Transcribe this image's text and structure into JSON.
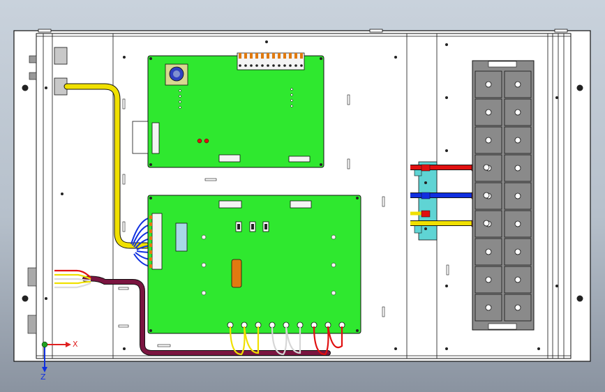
{
  "viewport": {
    "background_top": "#c9d2dc",
    "background_bottom": "#8a93a0"
  },
  "colors": {
    "enclosure": "#ffffff",
    "outline": "#111111",
    "pcb": "#2fe82f",
    "cable_yellow": "#f0e000",
    "cable_maroon": "#7a1540",
    "wire_red": "#e01010",
    "wire_blue": "#1030e0",
    "wire_white": "#f4f4f4",
    "busbar": "#5fd4d4",
    "breaker_block": "#8a8a8a",
    "capacitor": "#e07a10",
    "triad_x": "#e02020",
    "triad_y": "#20a020",
    "triad_z": "#1030e0"
  },
  "triad": {
    "x_label": "X",
    "z_label": "Z"
  },
  "icons": {
    "triad": "coordinate-triad-icon"
  }
}
